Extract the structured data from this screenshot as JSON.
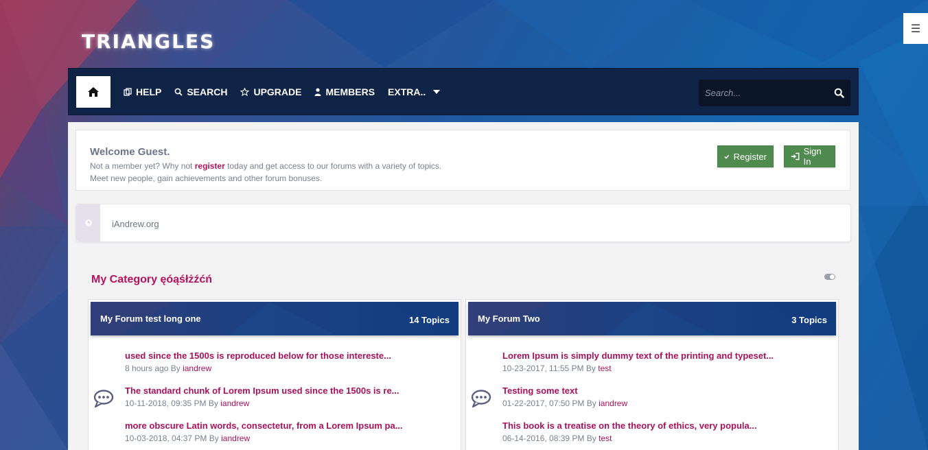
{
  "site": {
    "logo": "TRIANGLES",
    "menu_toggle": "☰"
  },
  "nav": {
    "items": [
      {
        "label": "HELP",
        "icon": "help-icon"
      },
      {
        "label": "SEARCH",
        "icon": "search-icon"
      },
      {
        "label": "UPGRADE",
        "icon": "star-icon"
      },
      {
        "label": "MEMBERS",
        "icon": "user-icon"
      },
      {
        "label": "EXTRA..",
        "icon": "caret-down-icon"
      }
    ],
    "search_placeholder": "Search..."
  },
  "welcome": {
    "title": "Welcome Guest.",
    "line1_pre": "Not a member yet? Why not ",
    "line1_link": "register",
    "line1_post": " today and get access to our forums with a variety of topics.",
    "line2": "Meet new people, gain achievements and other forum bonuses.",
    "register_label": "Register",
    "signin_label": "Sign In"
  },
  "site_row": {
    "name": "iAndrew.org"
  },
  "category": {
    "title": "My Category ęóąśłżźćń"
  },
  "forums": [
    {
      "name": "My Forum test long one",
      "topics_label": "14 Topics",
      "topics": [
        {
          "title": "used since the 1500s is reproduced below for those intereste...",
          "time": "8 hours ago",
          "by": "By",
          "user": "iandrew"
        },
        {
          "title": "The standard chunk of Lorem Ipsum used since the 1500s is re...",
          "time": "10-11-2018, 09:35 PM",
          "by": "By",
          "user": "iandrew"
        },
        {
          "title": "more obscure Latin words, consectetur, from a Lorem Ipsum pa...",
          "time": "10-03-2018, 04:37 PM",
          "by": "By",
          "user": "iandrew"
        }
      ]
    },
    {
      "name": "My Forum Two",
      "topics_label": "3 Topics",
      "topics": [
        {
          "title": "Lorem Ipsum is simply dummy text of the printing and typeset...",
          "time": "10-23-2017, 11:55 PM",
          "by": "By",
          "user": "test"
        },
        {
          "title": "Testing some text",
          "time": "01-22-2017, 07:50 PM",
          "by": "By",
          "user": "iandrew"
        },
        {
          "title": "This book is a treatise on the theory of ethics, very popula...",
          "time": "06-14-2016, 08:39 PM",
          "by": "By",
          "user": "test"
        }
      ]
    }
  ],
  "colors": {
    "accent": "#b5125c",
    "nav_bg": "#0f2346",
    "button_green": "#4f8a4e"
  }
}
